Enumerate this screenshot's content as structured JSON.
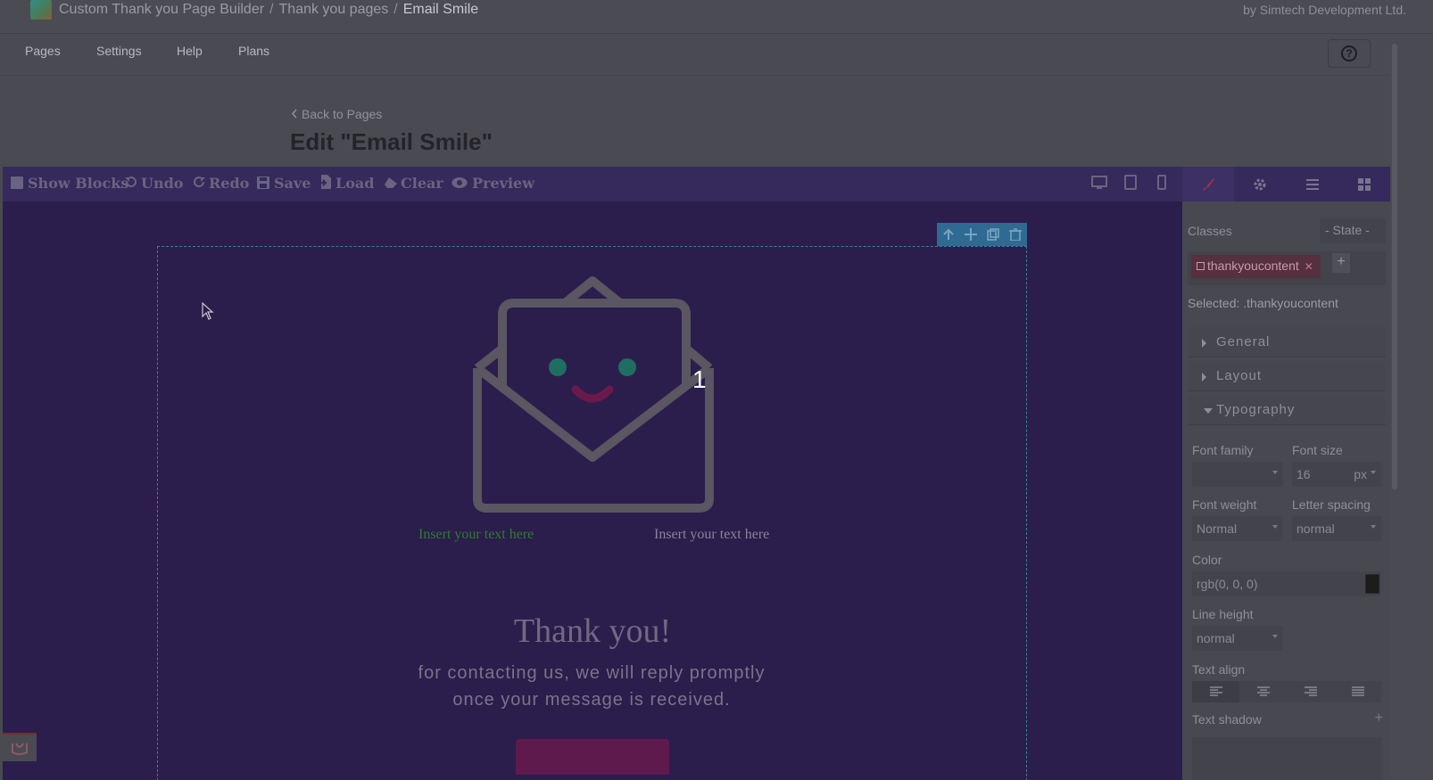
{
  "app": {
    "breadcrumbs": [
      "Custom Thank you Page Builder",
      "Thank you pages",
      "Email Smile"
    ],
    "vendor": "by Simtech Development Ltd."
  },
  "nav": {
    "tabs": [
      "Pages",
      "Settings",
      "Help",
      "Plans"
    ],
    "help_icon": "?"
  },
  "page": {
    "back_label": "Back to Pages",
    "title": "Edit \"Email Smile\""
  },
  "toolbar": {
    "show_blocks": "Show Blocks",
    "undo": "Undo",
    "redo": "Redo",
    "save": "Save",
    "load": "Load",
    "clear": "Clear",
    "preview": "Preview",
    "devices": [
      "desktop-icon",
      "tablet-icon",
      "mobile-icon"
    ]
  },
  "canvas": {
    "badge": "1",
    "insert_left": "Insert your text here",
    "insert_right": "Insert your text here",
    "thanks_title": "Thank you!",
    "thanks_line1": "for contacting us, we will reply promptly",
    "thanks_line2": "once your message is received."
  },
  "panel": {
    "tabs": [
      "brush-icon",
      "gear-icon",
      "layers-icon",
      "blocks-icon"
    ],
    "classes_label": "Classes",
    "state_label": "- State -",
    "class_tag": "thankyoucontent",
    "add_label": "+",
    "selected": "Selected: .thankyoucontent",
    "sections": {
      "general": "General",
      "layout": "Layout",
      "typography": "Typography"
    },
    "typography": {
      "font_family_label": "Font family",
      "font_family_value": "",
      "font_size_label": "Font size",
      "font_size_value": "16",
      "font_size_unit": "px",
      "font_weight_label": "Font weight",
      "font_weight_value": "Normal",
      "letter_spacing_label": "Letter spacing",
      "letter_spacing_value": "normal",
      "color_label": "Color",
      "color_value": "rgb(0, 0, 0)",
      "line_height_label": "Line height",
      "line_height_value": "normal",
      "text_align_label": "Text align",
      "text_shadow_label": "Text shadow",
      "text_shadow_add": "+"
    }
  },
  "colors": {
    "editor_bg": "#2b1d4c",
    "toolbar_bg": "#352a5b",
    "envelope_stroke": "#5a5662",
    "eye": "#1e6e62",
    "smile": "#6a1a4a",
    "cta": "#5e1a4d"
  }
}
